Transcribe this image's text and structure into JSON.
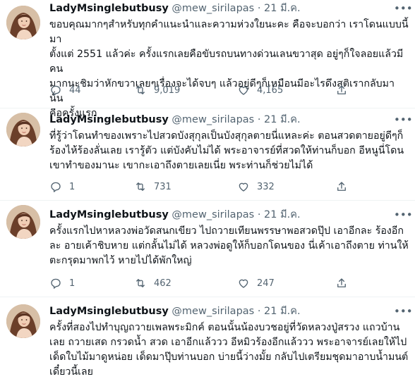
{
  "tweets": [
    {
      "name": "LadyMsinglebutbusy",
      "handle": "@mew_sirilapas",
      "separator": "·",
      "date": "21 มี.ค.",
      "lines": [
        "ขอบคุณมากๆสำหรับทุกคำแนะนำและความห่วงใยนะคะ คือจะบอกว่า เราโดนแบบนี้มา",
        "ตั้งแต่ 2551 แล้วค่ะ ครั้งแรกเลยคือขับรถบนทางด่วนเลนขวาสุด อยู่ๆก็ใจลอยแล้วมีคน",
        "มากนะชิมว่าหักขวาเลยๆเรื่องจะได้จบๆ แล้วอยู่ดีๆก็เหมือนมีอะไรดึงสติเรากลับมา นั่น",
        "คือครั้งแรก"
      ],
      "replies": "44",
      "retweets": "9,019",
      "likes": "4,165"
    },
    {
      "name": "LadyMsinglebutbusy",
      "handle": "@mew_sirilapas",
      "separator": "·",
      "date": "21 มี.ค.",
      "lines": [
        "ที่รู้ว่าโดนทำของเพราะไปสวดบังสุกุลเป็นบังสุกุลตายนี่แหละค่ะ ตอนสวดตายอยู่ดีๆก็",
        "ร้องไห้ร้องลั่นเลย เรารู้ตัว แต่บังคับไม่ได้ พระอาจารย์ที่สวดให้ท่านก็บอก อีหนูนี่โดน",
        "เขาทำของมานะ เขากะเอาถึงตายเลยเนี่ย พระท่านก็ช่วยไม่ได้"
      ],
      "replies": "1",
      "retweets": "731",
      "likes": "332"
    },
    {
      "name": "LadyMsinglebutbusy",
      "handle": "@mew_sirilapas",
      "separator": "·",
      "date": "21 มี.ค.",
      "lines": [
        "ครั้งแรกไปหาหลวงพ่อวัดสนกเขียว ไปถวายเทียนพรรษาพอสวดปุ๊ป เอาอีกละ ร้องอีก",
        "ละ อายเค้าชิบหาย แต่กลั้นไม่ได้ หลวงพ่อดูให้ก็บอกโดนของ นี่เค้าเอาถึงตาย ท่านให้",
        "ตะกรุดมาพกไว้ หายไปได้พักใหญ่"
      ],
      "replies": "1",
      "retweets": "462",
      "likes": "247"
    },
    {
      "name": "LadyMsinglebutbusy",
      "handle": "@mew_sirilapas",
      "separator": "·",
      "date": "21 มี.ค.",
      "lines": [
        "ครั้งที่สองไปทำบุญถวายเพลพระมิกค์ ตอนนั้นน้องบวชอยู่ที่วัดหลวงปู่สรวง แถวบ้าน",
        "เลย ถวายเสด กรวดน้ำ สวด เอาอีกแล้ววว อีหมิวร้องอีกแล้ววว พระอาจารย์เลยให้ไป",
        "เด็ดใบไม้มาดูหน่อย เด็ดมาปุ๊บท่านบอก บ่ายนี้ว่างมั้ย กลับไปเตรียมชุดมาอาบน้ำมนต์",
        "เดี๋ยวนี้เลย"
      ],
      "replies": "",
      "retweets": "",
      "likes": ""
    }
  ],
  "icons": {
    "reply": "reply-icon",
    "retweet": "retweet-icon",
    "like": "like-icon",
    "share": "share-icon",
    "more": "more-icon"
  },
  "colors": {
    "text": "#0f1419",
    "secondary": "#536471",
    "divider": "#eff3f4"
  }
}
